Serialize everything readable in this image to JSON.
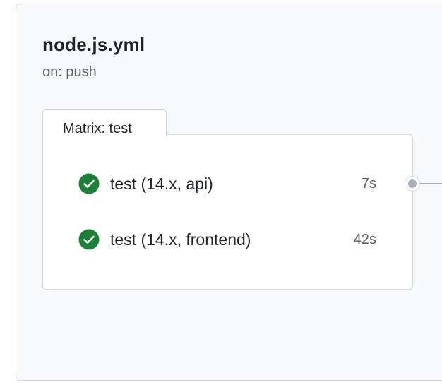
{
  "workflow": {
    "title": "node.js.yml",
    "trigger": "on: push"
  },
  "matrix": {
    "label": "Matrix: test",
    "jobs": [
      {
        "name": "test (14.x, api)",
        "duration": "7s",
        "status": "success",
        "icon": "check-circle-icon"
      },
      {
        "name": "test (14.x, frontend)",
        "duration": "42s",
        "status": "success",
        "icon": "check-circle-icon"
      }
    ]
  },
  "colors": {
    "success": "#1a7f37",
    "panel_bg": "#f6f8fa",
    "border": "#d0d7de",
    "connector": "#a9b1ba"
  }
}
